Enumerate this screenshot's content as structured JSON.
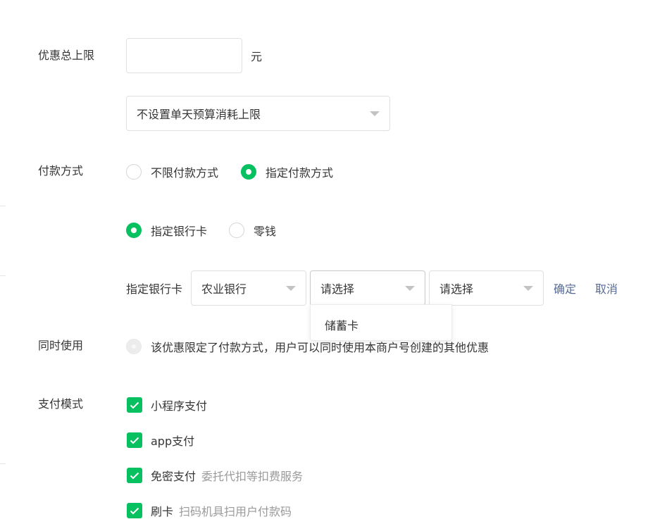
{
  "discount_limit": {
    "label": "优惠总上限",
    "value": "",
    "unit": "元"
  },
  "daily_budget": {
    "selected": "不设置单天预算消耗上限"
  },
  "payment_method": {
    "label": "付款方式",
    "options": [
      "不限付款方式",
      "指定付款方式"
    ],
    "selected_index": 1
  },
  "payment_type": {
    "options": [
      "指定银行卡",
      "零钱"
    ],
    "selected_index": 0
  },
  "bank_card": {
    "label": "指定银行卡",
    "bank": "农业银行",
    "card_type": "请选择",
    "card_level": "请选择",
    "confirm": "确定",
    "cancel": "取消",
    "dropdown_options": [
      "储蓄卡"
    ]
  },
  "concurrent_use": {
    "label": "同时使用",
    "text": "该优惠限定了付款方式，用户可以同时使用本商户号创建的其他优惠"
  },
  "pay_mode": {
    "label": "支付模式",
    "items": [
      {
        "label": "小程序支付",
        "hint": "",
        "checked": true
      },
      {
        "label": "app支付",
        "hint": "",
        "checked": true
      },
      {
        "label": "免密支付",
        "hint": "委托代扣等扣费服务",
        "checked": true
      },
      {
        "label": "刷卡",
        "hint": "扫码机具扫用户付款码",
        "checked": true
      }
    ]
  },
  "colors": {
    "accent": "#07c160",
    "link": "#576b95",
    "hint": "#9a9a9a",
    "text": "#353535"
  }
}
